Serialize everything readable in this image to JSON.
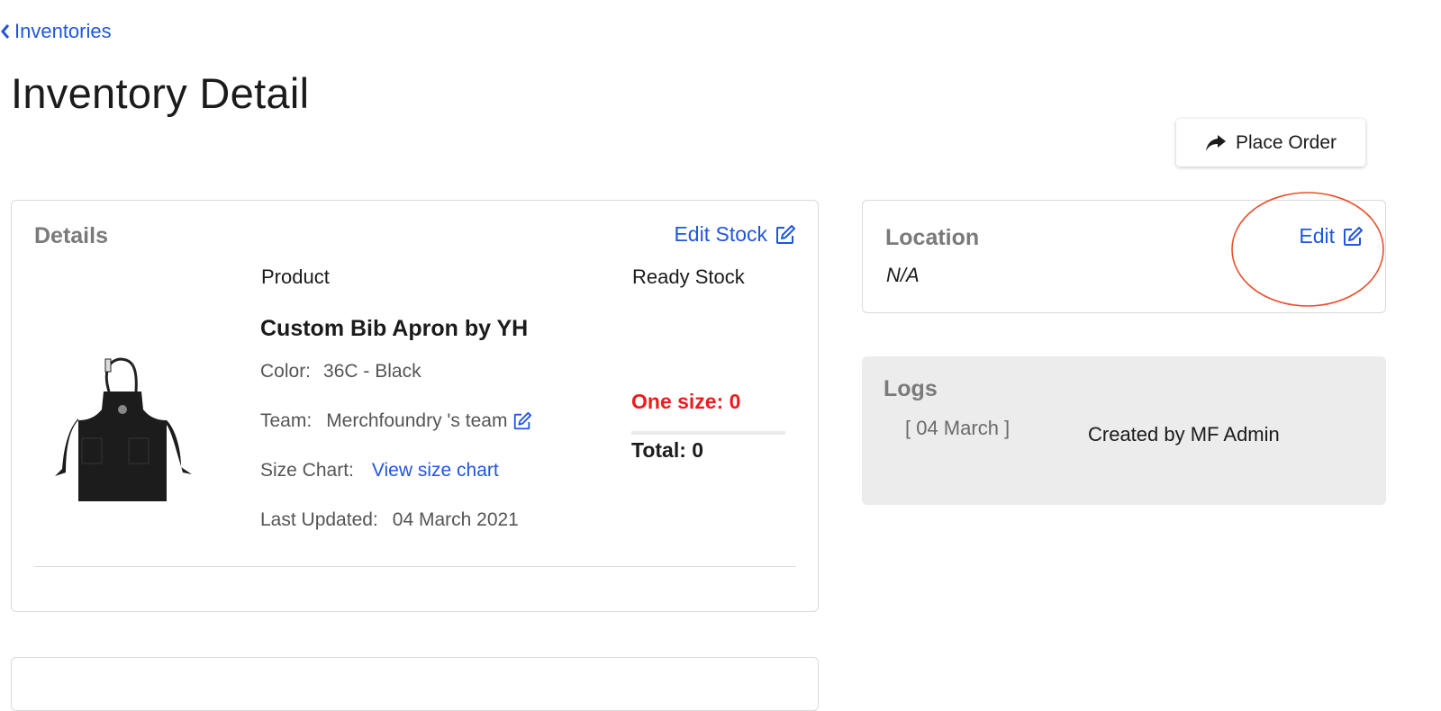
{
  "nav": {
    "back_label": "Inventories"
  },
  "page": {
    "title": "Inventory Detail"
  },
  "actions": {
    "place_order_label": "Place Order"
  },
  "details": {
    "heading": "Details",
    "edit_stock_label": "Edit Stock",
    "columns": {
      "product": "Product",
      "stock": "Ready Stock"
    },
    "product": {
      "name": "Custom Bib Apron by YH",
      "color_label": "Color:",
      "color_value": "36C - Black",
      "team_label": "Team:",
      "team_value": "Merchfoundry 's team",
      "size_chart_label": "Size Chart:",
      "size_chart_link": "View size chart",
      "last_updated_label": "Last Updated:",
      "last_updated_value": "04 March 2021"
    },
    "stock": {
      "one_size": "One size: 0",
      "total": "Total: 0"
    }
  },
  "location": {
    "heading": "Location",
    "value": "N/A",
    "edit_label": "Edit"
  },
  "logs": {
    "heading": "Logs",
    "entries": [
      {
        "date": "[ 04 March ]",
        "text": "Created by MF Admin"
      }
    ]
  },
  "colors": {
    "link": "#1f56e0",
    "alert": "#ee1c1c",
    "annotation": "#e8502a"
  },
  "icons": [
    "chevron-left-icon",
    "share-arrow-icon",
    "edit-icon",
    "apron-image"
  ]
}
